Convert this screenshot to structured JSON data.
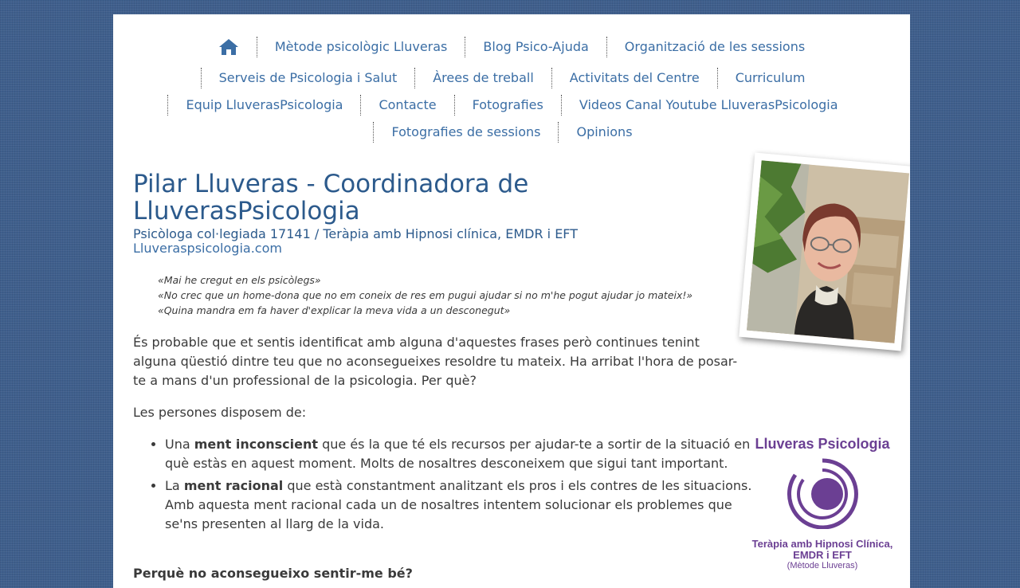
{
  "nav": {
    "row1": [
      "Mètode psicològic Lluveras",
      "Blog Psico-Ajuda",
      "Organització de les sessions"
    ],
    "row2": [
      "Serveis de Psicologia i Salut",
      "Àrees de treball",
      "Activitats del Centre",
      "Curriculum"
    ],
    "row3": [
      "Equip LluverasPsicologia",
      "Contacte",
      "Fotografies",
      "Videos Canal Youtube LluverasPsicologia"
    ],
    "row4": [
      "Fotografies de sessions",
      "Opinions"
    ],
    "home_icon": "home-icon"
  },
  "header": {
    "title": "Pilar Lluveras - Coordinadora de LluverasPsicologia",
    "subtitle": "Psicòloga col·legiada 17141 / Teràpia amb Hipnosi clínica, EMDR i EFT",
    "site_link": "Lluveraspsicologia.com"
  },
  "quotes": [
    "«Mai he cregut en els psicòlegs»",
    "«No crec que un home-dona que no em coneix de res em pugui ajudar si no m'he pogut ajudar jo mateix!»",
    "«Quina mandra em fa haver d'explicar la meva vida a un desconegut»"
  ],
  "body": {
    "intro": "És probable que et sentis identificat amb alguna d'aquestes frases però continues tenint alguna qüestió dintre teu que no aconsegueixes resoldre tu mateix. Ha arribat l'hora de posar-te a mans d'un professional de la psicologia. Per què?",
    "lead": "Les persones disposem de:",
    "bullet1": {
      "pre": "Una ",
      "bold": "ment inconscient",
      "post": " que és la que té els recursos per ajudar-te a sortir de la situació en què estàs en aquest moment. Molts de nosaltres desconeixem que sigui tant important."
    },
    "bullet2": {
      "pre": "La ",
      "bold": "ment racional",
      "post": " que està constantment analitzant els pros i els contres de les situacions. Amb aquesta ment racional cada un de nosaltres intentem solucionar els problemes que se'ns presenten al llarg de la vida."
    },
    "next_heading": "Perquè no aconsegueixo sentir-me bé?"
  },
  "sidebar": {
    "brand_name": "Lluveras Psicologia",
    "tagline": "Teràpia amb Hipnosi Clínica, EMDR i EFT",
    "subtag": "(Mètode Lluveras)"
  },
  "colors": {
    "nav_link": "#3b6ea5",
    "title": "#2c5a8c",
    "brand_purple": "#6b3f93",
    "background": "#3f5f8c"
  }
}
